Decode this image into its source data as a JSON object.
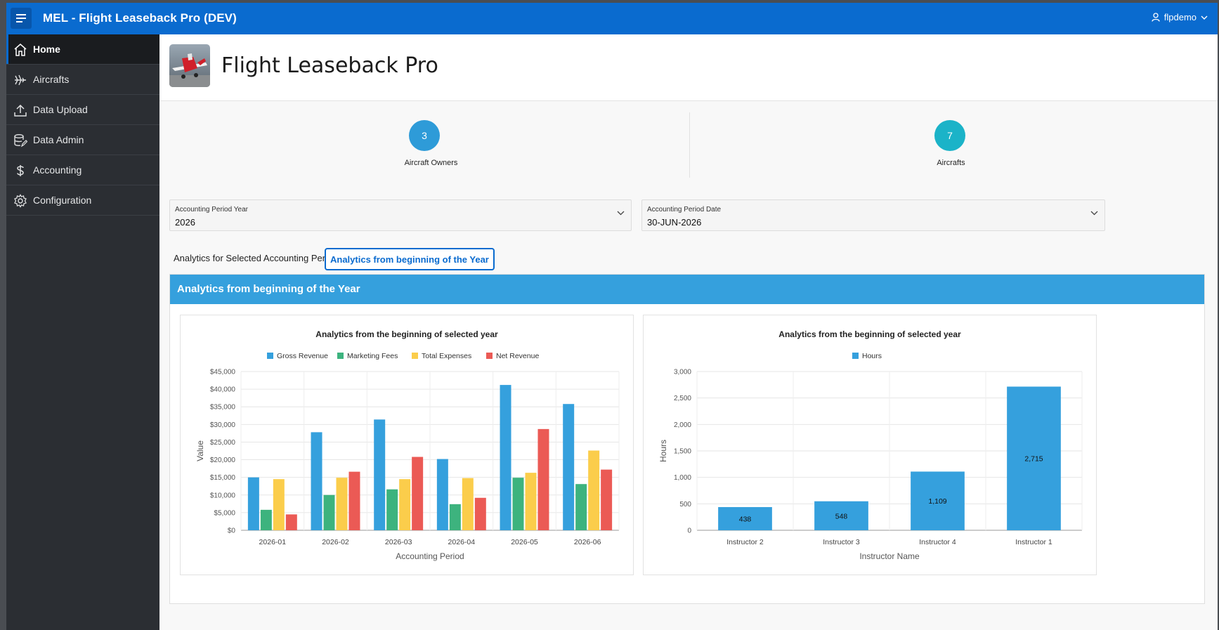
{
  "header": {
    "app_title": "MEL - Flight Leaseback Pro (DEV)",
    "user": "flpdemo"
  },
  "sidebar": {
    "items": [
      {
        "label": "Home",
        "icon": "home-icon",
        "active": true
      },
      {
        "label": "Aircrafts",
        "icon": "plane-icon",
        "active": false
      },
      {
        "label": "Data Upload",
        "icon": "upload-icon",
        "active": false
      },
      {
        "label": "Data Admin",
        "icon": "database-edit-icon",
        "active": false
      },
      {
        "label": "Accounting",
        "icon": "dollar-icon",
        "active": false
      },
      {
        "label": "Configuration",
        "icon": "gear-icon",
        "active": false
      }
    ]
  },
  "hero": {
    "title": "Flight Leaseback Pro"
  },
  "stats": [
    {
      "value": "3",
      "label": "Aircraft Owners",
      "color": "#2e9bd8"
    },
    {
      "value": "7",
      "label": "Aircrafts",
      "color": "#1bb3c8"
    }
  ],
  "filters": {
    "year": {
      "label": "Accounting Period Year",
      "value": "2026"
    },
    "date": {
      "label": "Accounting Period Date",
      "value": "30-JUN-2026"
    }
  },
  "tabs": [
    {
      "label": "Analytics for Selected Accounting Period",
      "active": false
    },
    {
      "label": "Analytics from beginning of the Year",
      "active": true
    }
  ],
  "region": {
    "title": "Analytics from beginning of the Year"
  },
  "chart_data": [
    {
      "type": "bar",
      "title": "Analytics from the beginning of selected year",
      "xlabel": "Accounting Period",
      "ylabel": "Value",
      "categories": [
        "2026-01",
        "2026-02",
        "2026-03",
        "2026-04",
        "2026-05",
        "2026-06"
      ],
      "ylim": [
        0,
        45000
      ],
      "yticks": [
        "$0",
        "$5,000",
        "$10,000",
        "$15,000",
        "$20,000",
        "$25,000",
        "$30,000",
        "$35,000",
        "$40,000",
        "$45,000"
      ],
      "series": [
        {
          "name": "Gross Revenue",
          "color": "#35a0dd",
          "values": [
            15000,
            27800,
            31400,
            20200,
            41200,
            35800
          ]
        },
        {
          "name": "Marketing Fees",
          "color": "#3db37e",
          "values": [
            5800,
            10000,
            11600,
            7400,
            14900,
            13100
          ]
        },
        {
          "name": "Total Expenses",
          "color": "#fbcd4b",
          "values": [
            14500,
            14900,
            14500,
            14800,
            16300,
            22600
          ]
        },
        {
          "name": "Net Revenue",
          "color": "#eb5a55",
          "values": [
            4500,
            16600,
            20800,
            9200,
            28700,
            17200
          ]
        }
      ],
      "grid": true,
      "legend": "top"
    },
    {
      "type": "bar",
      "title": "Analytics from the beginning of selected year",
      "xlabel": "Instructor Name",
      "ylabel": "Hours",
      "categories": [
        "Instructor 2",
        "Instructor 3",
        "Instructor 4",
        "Instructor 1"
      ],
      "ylim": [
        0,
        3000
      ],
      "yticks": [
        "0",
        "500",
        "1,000",
        "1,500",
        "2,000",
        "2,500",
        "3,000"
      ],
      "series": [
        {
          "name": "Hours",
          "color": "#35a0dd",
          "values": [
            438,
            548,
            1109,
            2715
          ]
        }
      ],
      "data_labels": [
        "438",
        "548",
        "1,109",
        "2,715"
      ],
      "grid": true,
      "legend": "top"
    }
  ]
}
